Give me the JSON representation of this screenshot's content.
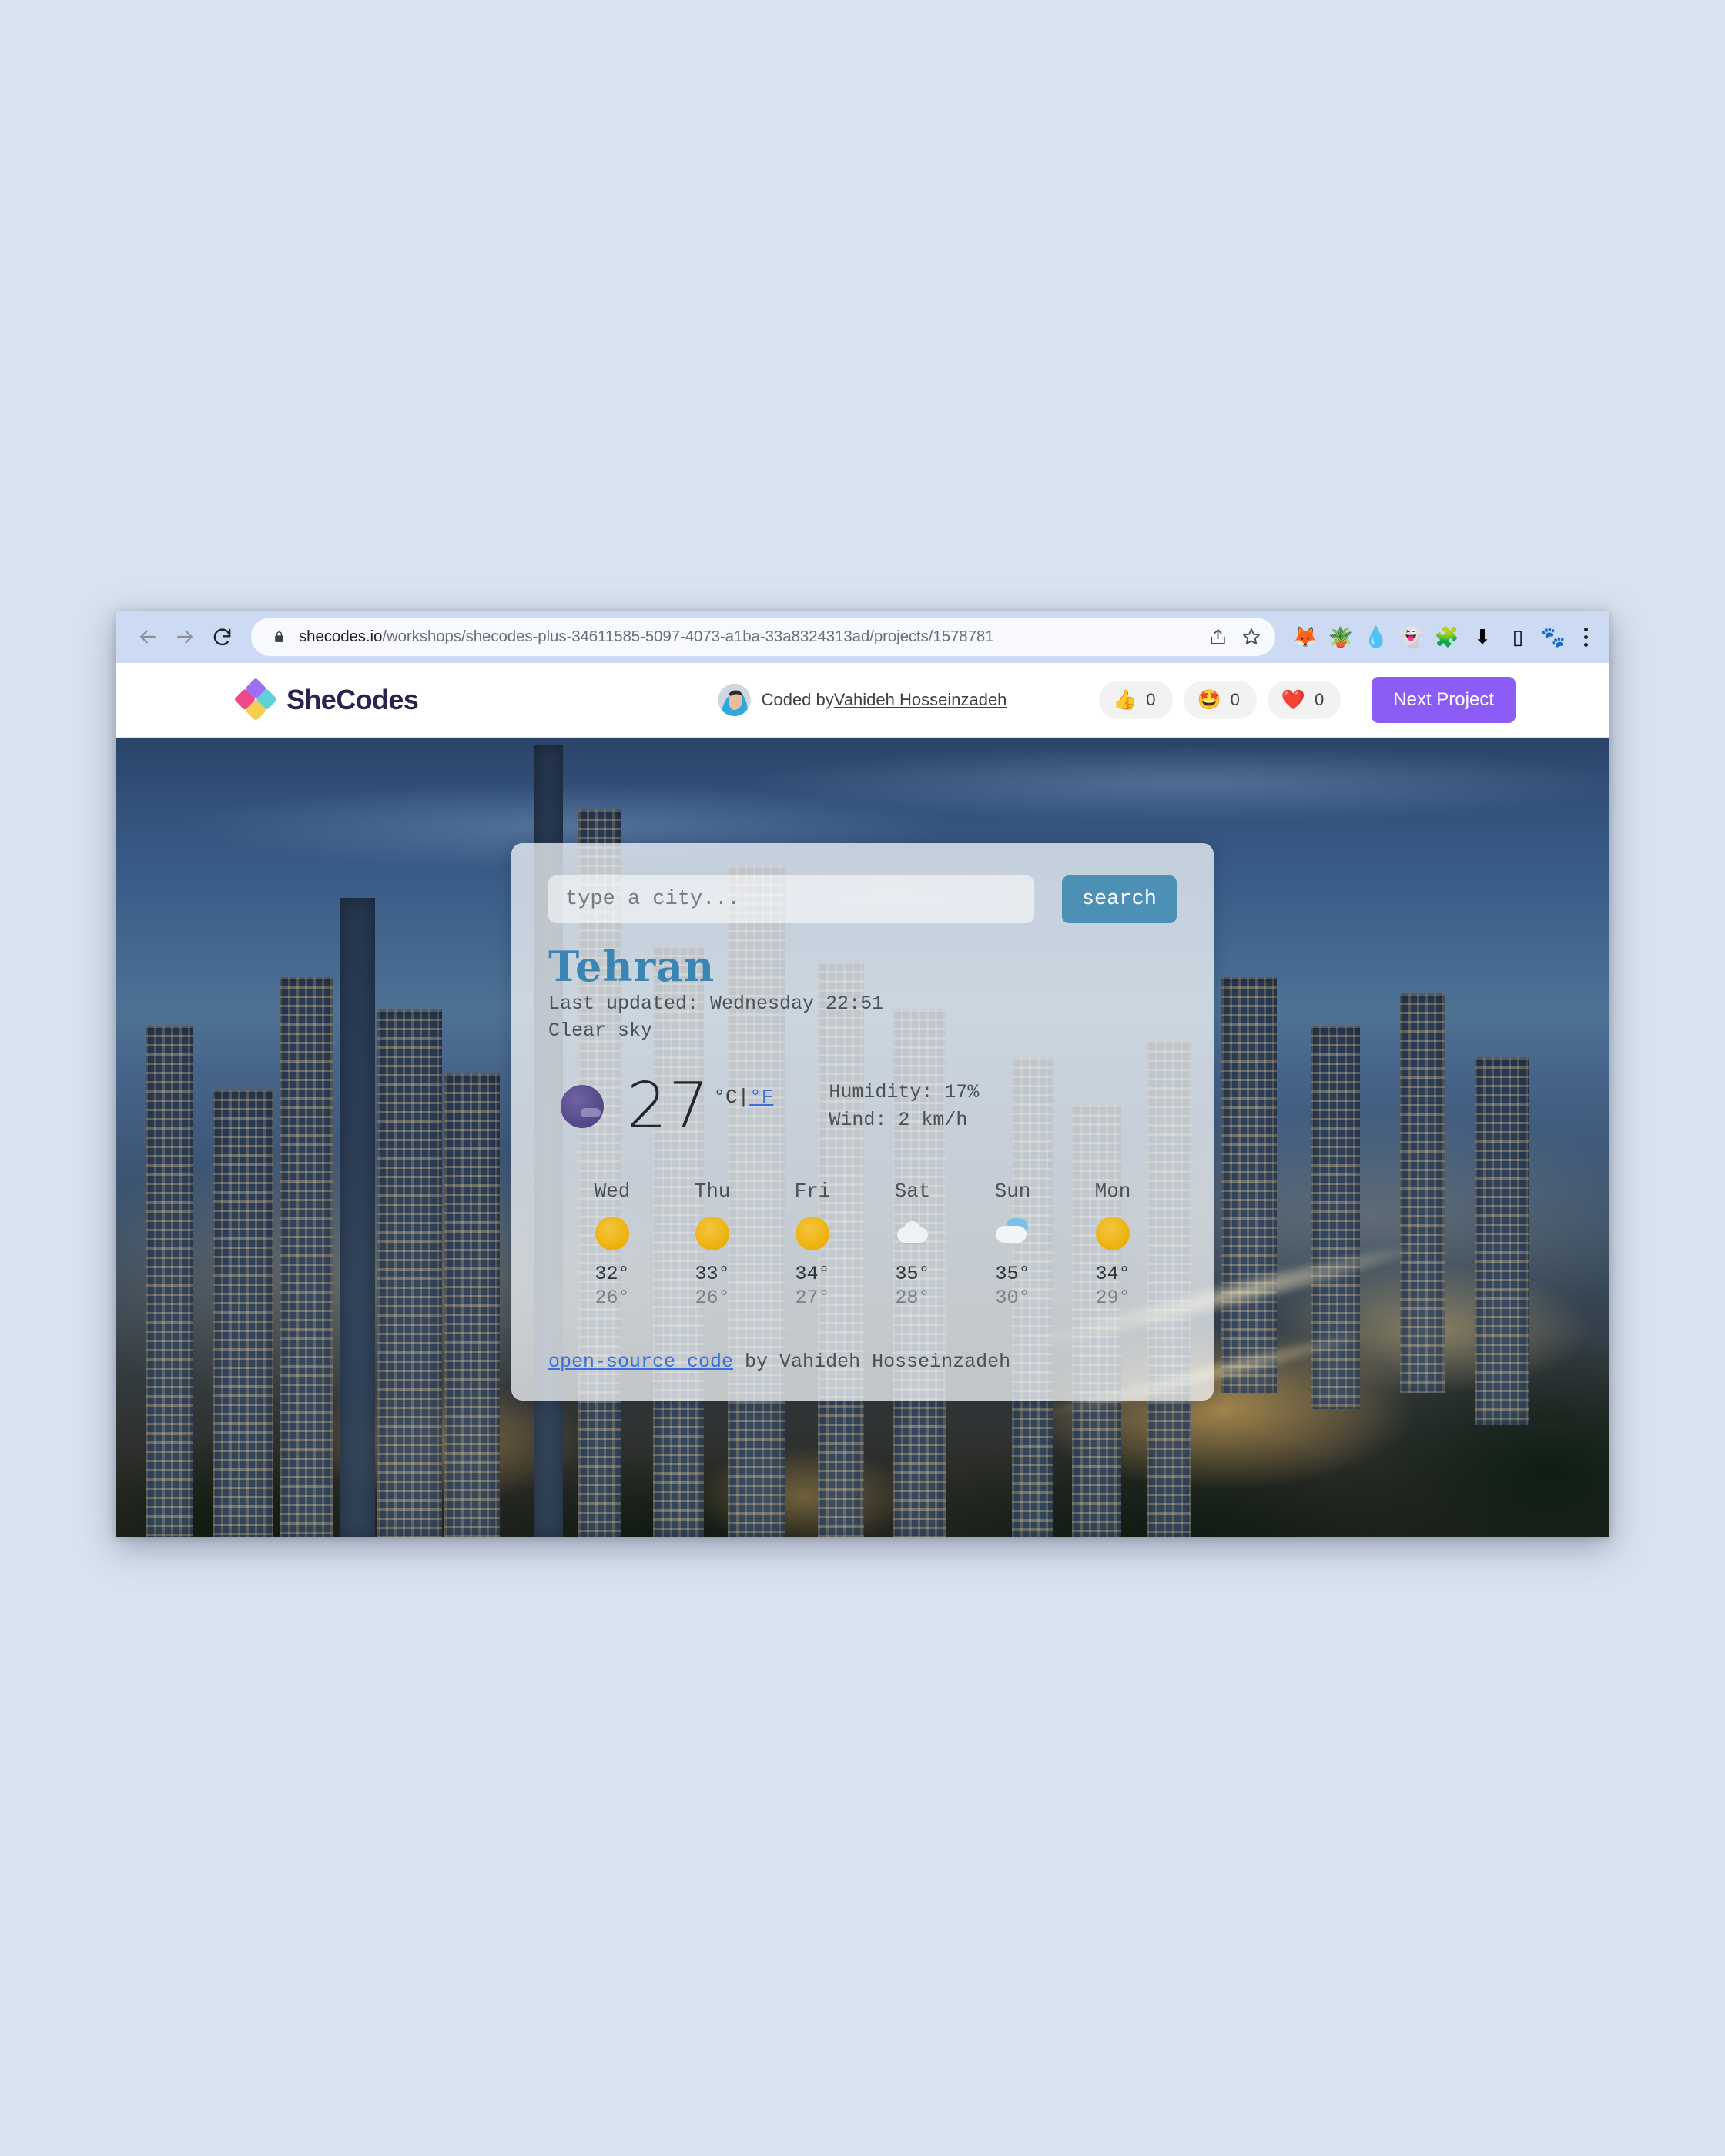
{
  "browser": {
    "back_icon": "back-arrow-icon",
    "forward_icon": "forward-arrow-icon",
    "reload_icon": "reload-icon",
    "lock_icon": "lock-icon",
    "url_host": "shecodes.io",
    "url_path": "/workshops/shecodes-plus-34611585-5097-4073-a1ba-33a8324313ad/projects/1578781",
    "share_icon": "share-icon",
    "bookmark_icon": "star-icon",
    "extensions": [
      {
        "name": "fox-extension-icon",
        "glyph": "🦊"
      },
      {
        "name": "frog-extension-icon",
        "glyph": "🪴"
      },
      {
        "name": "water-drop-extension-icon",
        "glyph": "💧"
      },
      {
        "name": "ghost-extension-icon",
        "glyph": "👻"
      },
      {
        "name": "puzzle-extensions-icon",
        "glyph": "🧩"
      },
      {
        "name": "download-icon",
        "glyph": "⬇"
      },
      {
        "name": "side-panel-icon",
        "glyph": "▯"
      },
      {
        "name": "profile-avatar-icon",
        "glyph": "🐾"
      }
    ],
    "menu_icon": "kebab-menu-icon"
  },
  "header": {
    "logo_text": "SheCodes",
    "coded_by_prefix": "Coded by ",
    "author": "Vahideh Hosseinzadeh",
    "avatar_name": "author-avatar",
    "reactions": [
      {
        "name": "thumbs-up-reaction",
        "emoji": "👍",
        "count": "0"
      },
      {
        "name": "star-struck-reaction",
        "emoji": "🤩",
        "count": "0"
      },
      {
        "name": "heart-reaction",
        "emoji": "❤️",
        "count": "0"
      }
    ],
    "next_project_label": "Next Project",
    "accent_color": "#8b5cf6"
  },
  "weather": {
    "search": {
      "placeholder": "type a city...",
      "value": "",
      "button_label": "search",
      "button_color": "#4d90b6"
    },
    "city": "Tehran",
    "city_color": "#3b85b3",
    "last_updated": "Last updated: Wednesday 22:51",
    "description": "Clear sky",
    "current": {
      "icon_name": "moon-clear-night-icon",
      "temperature": "27",
      "unit_celsius": "°C",
      "unit_separator": "|",
      "unit_fahrenheit": "°F",
      "active_unit": "celsius",
      "humidity": "Humidity: 17%",
      "wind": "Wind: 2 km/h"
    },
    "forecast": [
      {
        "day": "Wed",
        "icon": "sun-icon",
        "icon_class": "sun",
        "max": "32°",
        "min": "26°"
      },
      {
        "day": "Thu",
        "icon": "sun-icon",
        "icon_class": "sun",
        "max": "33°",
        "min": "26°"
      },
      {
        "day": "Fri",
        "icon": "sun-icon",
        "icon_class": "sun",
        "max": "34°",
        "min": "27°"
      },
      {
        "day": "Sat",
        "icon": "cloud-icon",
        "icon_class": "cloud",
        "max": "35°",
        "min": "28°"
      },
      {
        "day": "Sun",
        "icon": "partly-cloudy-icon",
        "icon_class": "partly",
        "max": "35°",
        "min": "30°"
      },
      {
        "day": "Mon",
        "icon": "sun-icon",
        "icon_class": "sun",
        "max": "34°",
        "min": "29°"
      }
    ],
    "footer": {
      "link_label": "open-source code",
      "suffix": " by Vahideh Hosseinzadeh"
    }
  }
}
